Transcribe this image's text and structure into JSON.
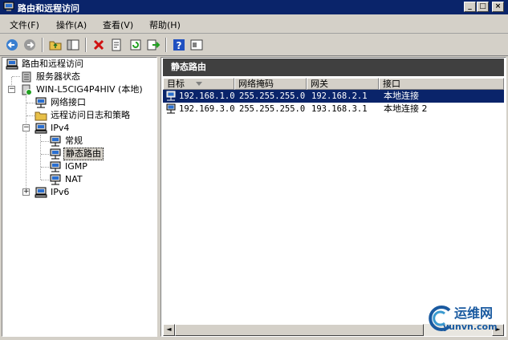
{
  "window": {
    "title": "路由和远程访问",
    "min_label": "_",
    "max_label": "□",
    "close_label": "×"
  },
  "menu": {
    "items": [
      "文件(F)",
      "操作(A)",
      "查看(V)",
      "帮助(H)"
    ]
  },
  "tree": {
    "root": "路由和远程访问",
    "server_status": "服务器状态",
    "server": "WIN-L5CIG4P4HIV (本地)",
    "network_interfaces": "网络接口",
    "remote_logging": "远程访问日志和策略",
    "ipv4": "IPv4",
    "general": "常规",
    "static_routes": "静态路由",
    "igmp": "IGMP",
    "nat": "NAT",
    "ipv6": "IPv6",
    "expand_minus": "−",
    "expand_plus": "+"
  },
  "right": {
    "header": "静态路由",
    "columns": [
      "目标",
      "网络掩码",
      "网关",
      "接口"
    ],
    "rows": [
      {
        "dest": "192.168.1.0",
        "mask": "255.255.255.0",
        "gateway": "192.168.2.1",
        "iface": "本地连接"
      },
      {
        "dest": "192.169.3.0",
        "mask": "255.255.255.0",
        "gateway": "193.168.3.1",
        "iface": "本地连接 2"
      }
    ],
    "scroll_left": "◄",
    "scroll_right": "►"
  },
  "watermark": {
    "brand": "运维网",
    "url": "yunvn.com"
  },
  "colors": {
    "title_bg": "#0a246a",
    "selection": "#0a246a",
    "pane_header": "#404040",
    "watermark": "#1a5aa0"
  }
}
